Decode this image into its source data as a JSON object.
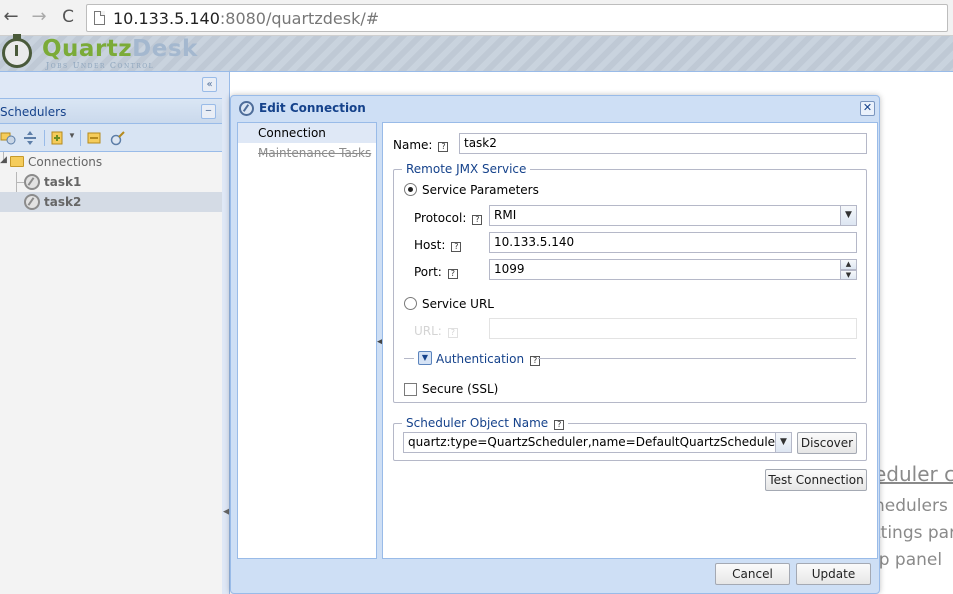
{
  "browser": {
    "url_host": "10.133.5.140",
    "url_rest": ":8080/quartzdesk/#"
  },
  "app": {
    "logo_primary": "Quartz",
    "logo_secondary": "Desk",
    "tagline": "Jobs Under Control"
  },
  "left_panel": {
    "title": "Schedulers",
    "tree": {
      "root_label": "Connections",
      "items": [
        {
          "label": "task1",
          "selected": false
        },
        {
          "label": "task2",
          "selected": true
        }
      ]
    }
  },
  "background": {
    "line1": "eduler co",
    "line2": "hedulers",
    "line3": "ttings par",
    "line4": "lp panel"
  },
  "dialog": {
    "title": "Edit Connection",
    "nav": {
      "items": [
        {
          "label": "Connection",
          "state": "active"
        },
        {
          "label": "Maintenance Tasks",
          "state": "disabled"
        }
      ]
    },
    "form": {
      "name_label": "Name:",
      "name_value": "task2",
      "remote_jmx_legend": "Remote JMX Service",
      "service_params_label": "Service Parameters",
      "protocol_label": "Protocol:",
      "protocol_value": "RMI",
      "host_label": "Host:",
      "host_value": "10.133.5.140",
      "port_label": "Port:",
      "port_value": "1099",
      "service_url_label": "Service URL",
      "url_label": "URL:",
      "url_value": "",
      "authentication_label": "Authentication",
      "secure_label": "Secure (SSL)",
      "scheduler_object_legend": "Scheduler Object Name",
      "scheduler_object_value": "quartz:type=QuartzScheduler,name=DefaultQuartzScheduler,instance",
      "discover_label": "Discover",
      "test_connection_label": "Test Connection"
    },
    "buttons": {
      "cancel": "Cancel",
      "update": "Update"
    }
  },
  "colors": {
    "accent": "#15428b",
    "panel_bg": "#dfe8f6",
    "border": "#99bbe8",
    "logo_green": "#7bab38"
  }
}
